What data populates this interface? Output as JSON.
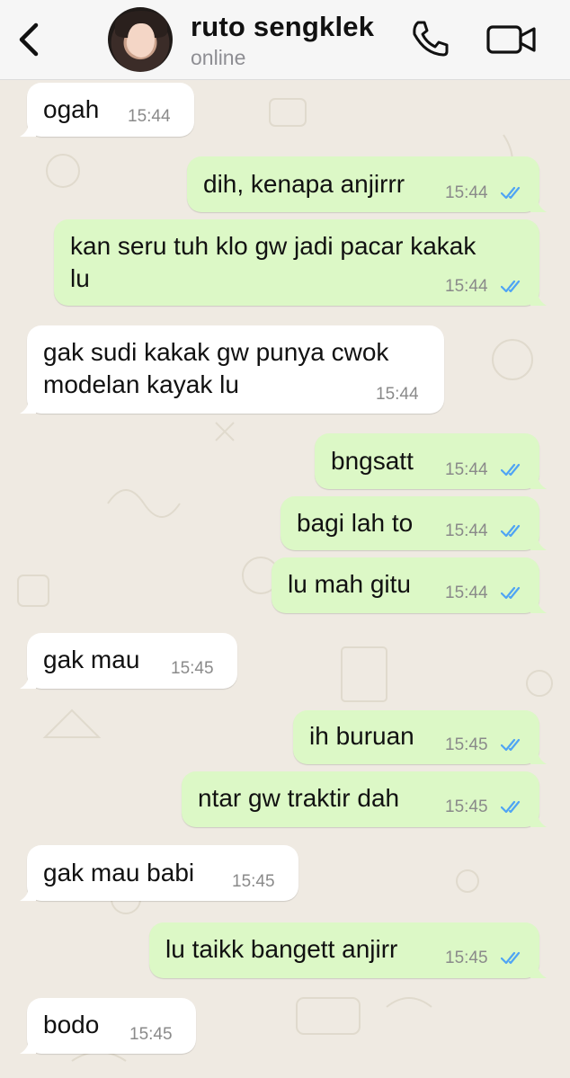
{
  "header": {
    "contact_name": "ruto sengklek",
    "status": "online"
  },
  "colors": {
    "incoming_bubble": "#ffffff",
    "outgoing_bubble": "#dcf8c6",
    "read_ticks": "#4fa4f4",
    "wallpaper": "#efeae2"
  },
  "messages": [
    {
      "direction": "in",
      "text": "ogah",
      "time": "15:44"
    },
    {
      "direction": "out",
      "text": "dih, kenapa anjirrr",
      "time": "15:44",
      "read": true
    },
    {
      "direction": "out",
      "text_lines": [
        "kan seru tuh klo gw jadi pacar kakak",
        "lu"
      ],
      "time": "15:44",
      "read": true
    },
    {
      "direction": "in",
      "text_lines": [
        "gak sudi kakak gw punya cwok",
        "modelan kayak lu"
      ],
      "time": "15:44"
    },
    {
      "direction": "out",
      "text": "bngsatt",
      "time": "15:44",
      "read": true
    },
    {
      "direction": "out",
      "text": "bagi lah to",
      "time": "15:44",
      "read": true
    },
    {
      "direction": "out",
      "text": "lu mah gitu",
      "time": "15:44",
      "read": true
    },
    {
      "direction": "in",
      "text": "gak mau",
      "time": "15:45"
    },
    {
      "direction": "out",
      "text": "ih buruan",
      "time": "15:45",
      "read": true
    },
    {
      "direction": "out",
      "text": "ntar gw traktir dah",
      "time": "15:45",
      "read": true
    },
    {
      "direction": "in",
      "text": "gak mau babi",
      "time": "15:45"
    },
    {
      "direction": "out",
      "text": "lu taikk bangett anjirr",
      "time": "15:45",
      "read": true
    },
    {
      "direction": "in",
      "text": "bodo",
      "time": "15:45"
    }
  ]
}
